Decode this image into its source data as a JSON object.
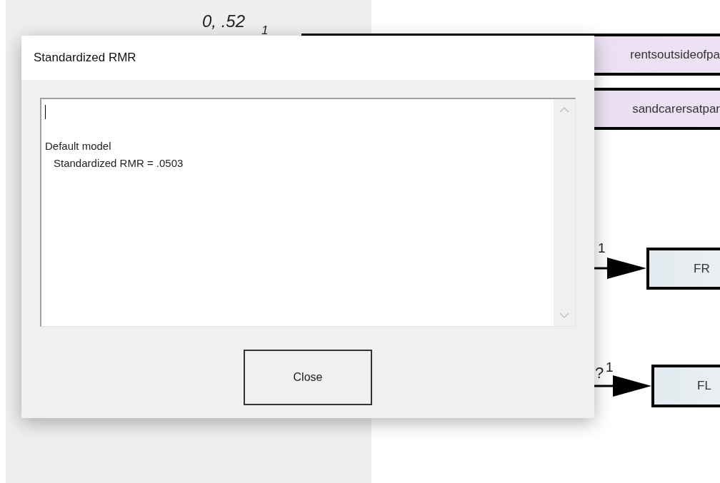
{
  "diagram": {
    "labels": [
      {
        "kind": "estimate",
        "text": "0, .52"
      },
      {
        "kind": "estimate",
        "text": "1"
      },
      {
        "kind": "weight",
        "text": "1"
      },
      {
        "kind": "weight",
        "text": "?"
      },
      {
        "kind": "weight",
        "text": "1"
      }
    ],
    "boxes": [
      {
        "kind": "observed",
        "text": "rentsoutsideofpa",
        "color": "#e8dcf0"
      },
      {
        "kind": "observed",
        "text": "sandcarersatpar",
        "color": "#e8dcf0"
      },
      {
        "kind": "indicator",
        "text": "FR",
        "color": "#e3ebf0"
      },
      {
        "kind": "indicator",
        "text": "FL",
        "color": "#e3ebf0"
      }
    ],
    "arrows": [
      {
        "kind": "path"
      },
      {
        "kind": "path"
      }
    ]
  },
  "dialog": {
    "title": "Standardized RMR",
    "output_lines": [
      {
        "kind": "cursor"
      },
      {
        "kind": "blank"
      },
      {
        "kind": "text",
        "text": "Default model"
      },
      {
        "kind": "indented",
        "text": "Standardized RMR = .0503"
      }
    ],
    "button": "Close"
  }
}
